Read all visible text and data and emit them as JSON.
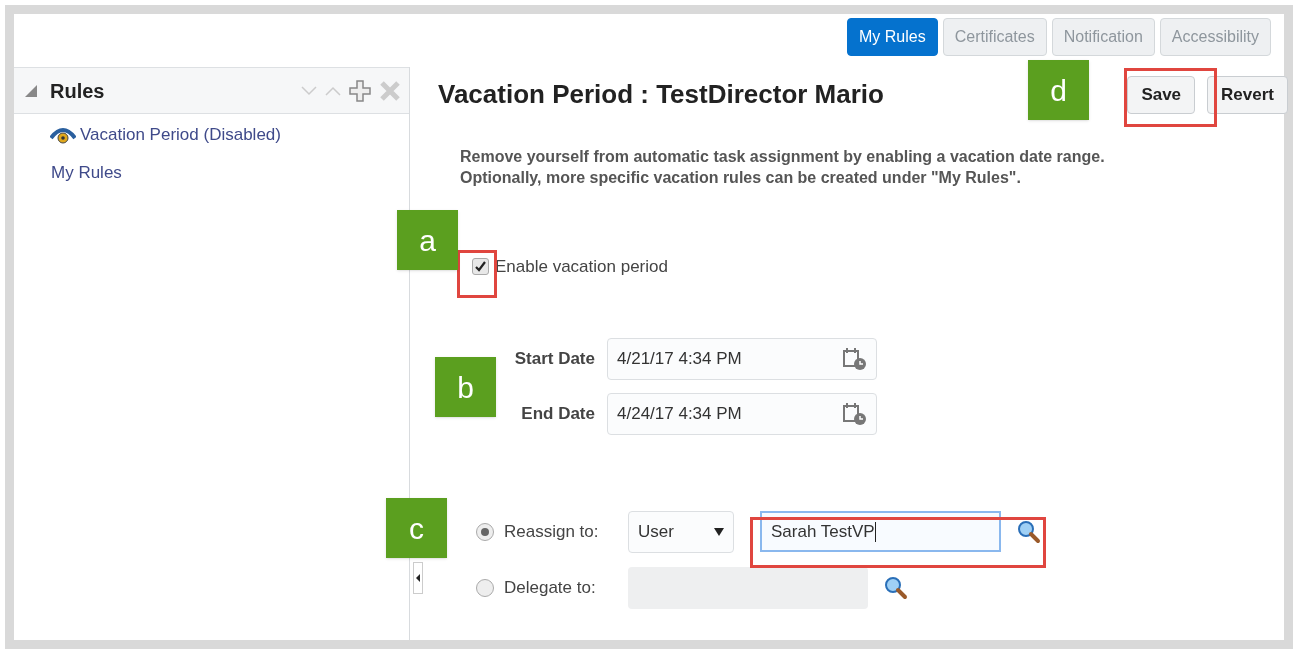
{
  "tabs": [
    {
      "label": "My Rules",
      "selected": true,
      "disabled": false
    },
    {
      "label": "Certificates",
      "selected": false,
      "disabled": true
    },
    {
      "label": "Notification",
      "selected": false,
      "disabled": true
    },
    {
      "label": "Accessibility",
      "selected": false,
      "disabled": true
    }
  ],
  "sidebar": {
    "title": "Rules",
    "expanded": true,
    "items": [
      {
        "label": "Vacation Period (Disabled)",
        "kind": "rule"
      },
      {
        "label": "My Rules",
        "kind": "folder"
      }
    ]
  },
  "page_title": "Vacation Period : TestDirector Mario",
  "buttons": [
    {
      "label": "Save"
    },
    {
      "label": "Revert"
    }
  ],
  "description": [
    "Remove yourself from automatic task assignment by enabling a vacation date range.",
    "Optionally, more specific vacation rules can be created under \"My Rules\"."
  ],
  "enable": {
    "label": "Enable vacation period",
    "checked": true
  },
  "dates": [
    {
      "label": "Start Date",
      "value": "4/21/17 4:34 PM"
    },
    {
      "label": "End Date",
      "value": "4/24/17 4:34 PM"
    }
  ],
  "assign": [
    {
      "label": "Reassign to:",
      "selected": true,
      "type": "User",
      "value": "Sarah TestVP"
    },
    {
      "label": "Delegate to:",
      "selected": false,
      "disabled": true
    }
  ],
  "callouts": [
    "a",
    "b",
    "c",
    "d"
  ]
}
